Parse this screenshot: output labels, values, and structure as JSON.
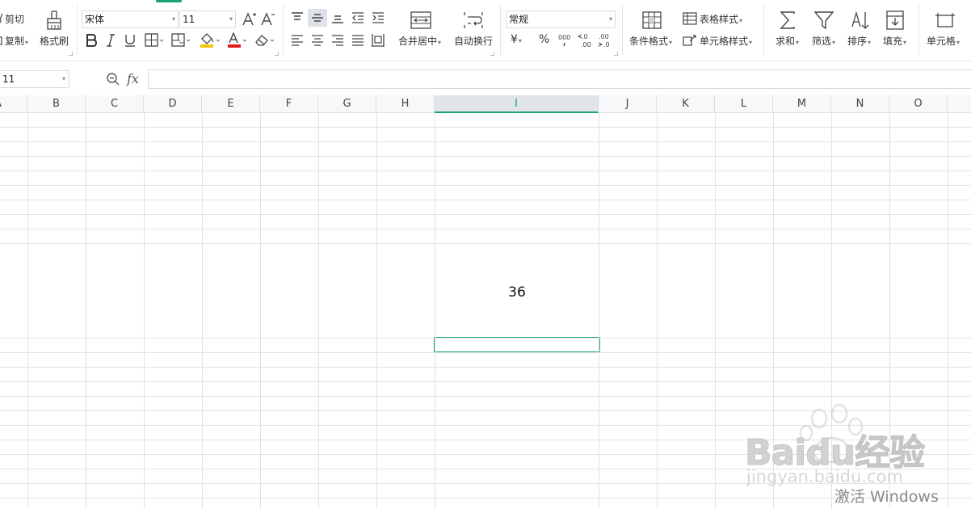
{
  "ribbon": {
    "clipboard": {
      "cut": "剪切",
      "copy": "复制",
      "format_painter": "格式刷"
    },
    "font": {
      "name": "宋体",
      "size": "11"
    },
    "alignment": {
      "merge_center": "合并居中",
      "wrap_text": "自动换行"
    },
    "number": {
      "format": "常规",
      "currency_symbol": "¥",
      "percent_symbol": "%"
    },
    "styles": {
      "conditional_format": "条件格式",
      "table_style": "表格样式",
      "cell_style": "单元格样式"
    },
    "editing": {
      "sum": "求和",
      "filter": "筛选",
      "sort": "排序",
      "fill": "填充",
      "cell": "单元格"
    },
    "colors": {
      "accent": "#1aa36e",
      "highlight_fill": "#f5c518",
      "font_color": "#e02020"
    }
  },
  "formula_bar": {
    "name_box": "11",
    "fx_label": "fx",
    "formula": ""
  },
  "grid": {
    "columns": [
      "A",
      "B",
      "C",
      "D",
      "E",
      "F",
      "G",
      "H",
      "I",
      "J",
      "K",
      "L",
      "M",
      "N",
      "O"
    ],
    "active_column": "I",
    "cell_value": "36"
  },
  "watermarks": {
    "logo_text": "Baidu经验",
    "site": "jingyan.baidu.com",
    "activation": "激活 Windows"
  }
}
